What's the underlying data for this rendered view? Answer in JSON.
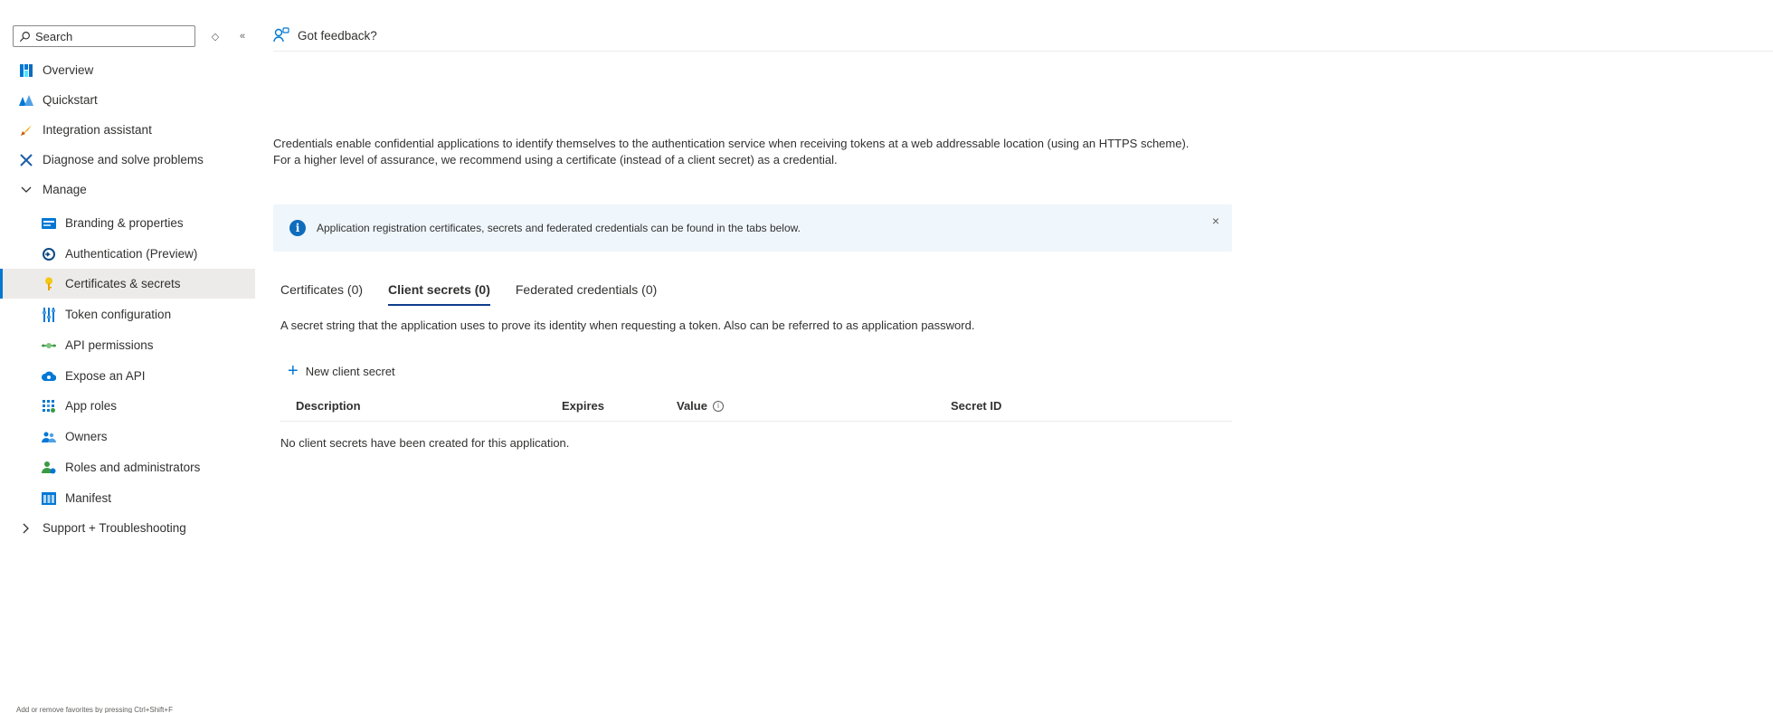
{
  "sidebar": {
    "search": {
      "placeholder": "Search"
    },
    "items": [
      {
        "label": "Overview",
        "icon": "overview-icon"
      },
      {
        "label": "Quickstart",
        "icon": "quickstart-icon"
      },
      {
        "label": "Integration assistant",
        "icon": "rocket-icon"
      },
      {
        "label": "Diagnose and solve problems",
        "icon": "wrench-icon"
      },
      {
        "label": "Manage",
        "icon": "chevron-down-icon"
      },
      {
        "label": "Branding & properties",
        "icon": "branding-icon"
      },
      {
        "label": "Authentication (Preview)",
        "icon": "authentication-icon"
      },
      {
        "label": "Certificates & secrets",
        "icon": "key-icon"
      },
      {
        "label": "Token configuration",
        "icon": "token-config-icon"
      },
      {
        "label": "API permissions",
        "icon": "api-permissions-icon"
      },
      {
        "label": "Expose an API",
        "icon": "cloud-icon"
      },
      {
        "label": "App roles",
        "icon": "app-roles-icon"
      },
      {
        "label": "Owners",
        "icon": "owners-icon"
      },
      {
        "label": "Roles and administrators",
        "icon": "roles-icon"
      },
      {
        "label": "Manifest",
        "icon": "manifest-icon"
      },
      {
        "label": "Support + Troubleshooting",
        "icon": "chevron-right-icon"
      }
    ],
    "bottom_note": "Add or remove favorites by pressing Ctrl+Shift+F"
  },
  "header": {
    "feedback_label": "Got feedback?"
  },
  "main": {
    "intro": "Credentials enable confidential applications to identify themselves to the authentication service when receiving tokens at a web addressable location (using an HTTPS scheme). For a higher level of assurance, we recommend using a certificate (instead of a client secret) as a credential.",
    "info_bar": {
      "text": "Application registration certificates, secrets and federated credentials can be found in the tabs below.",
      "close": "×"
    },
    "tabs": [
      {
        "label": "Certificates (0)"
      },
      {
        "label": "Client secrets (0)"
      },
      {
        "label": "Federated credentials (0)"
      }
    ],
    "tab_description": "A secret string that the application uses to prove its identity when requesting a token. Also can be referred to as application password.",
    "new_button": {
      "label": "New client secret"
    },
    "table": {
      "columns": [
        "Description",
        "Expires",
        "Value",
        "Secret ID"
      ],
      "empty_message": "No client secrets have been created for this application."
    }
  },
  "colors": {
    "accent": "#0078d4",
    "info_bg": "#eff6fc",
    "active_bg": "#edebe9"
  }
}
